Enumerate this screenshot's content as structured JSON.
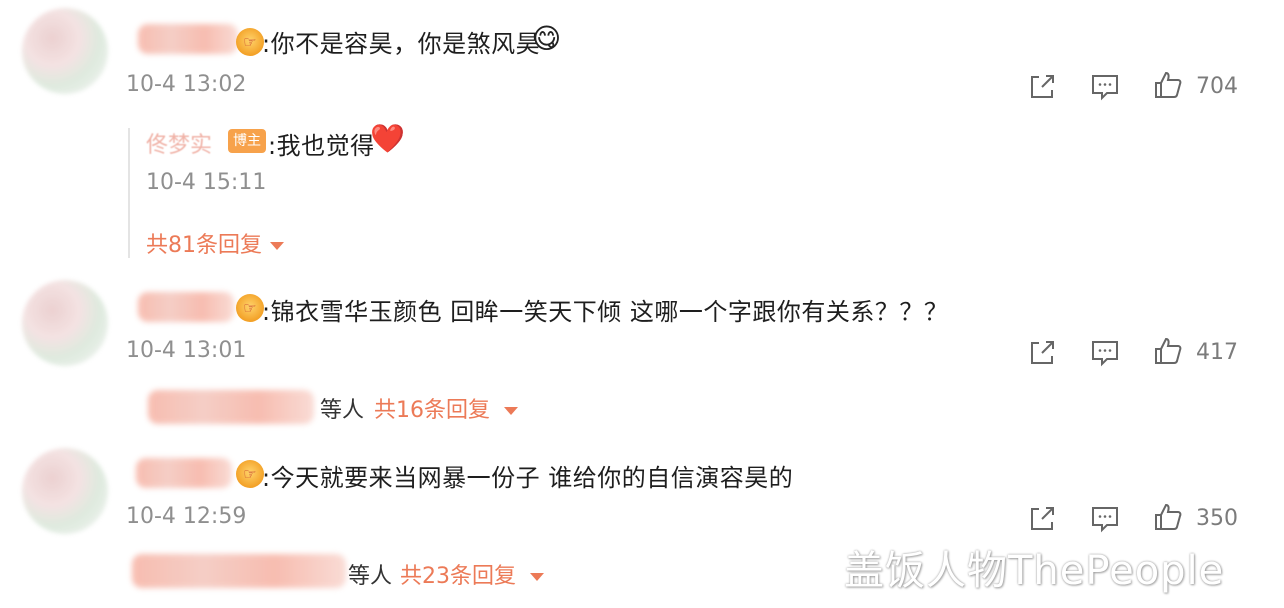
{
  "comments": [
    {
      "text": ":你不是容昊，你是煞风昊",
      "emoji": "😋",
      "time": "10-4 13:02",
      "likes": "704",
      "reply": {
        "name": "佟梦实",
        "badge": "博主",
        "text": ":我也觉得",
        "emoji": "❤️",
        "time": "10-4 15:11",
        "more": "共81条回复"
      }
    },
    {
      "text": ":锦衣雪华玉颜色 回眸一笑天下倾 这哪一个字跟你有关系？？？",
      "time": "10-4 13:01",
      "likes": "417",
      "replies_etc": "等人",
      "more": "共16条回复"
    },
    {
      "text": ":今天就要来当网暴一份子 谁给你的自信演容昊的",
      "time": "10-4 12:59",
      "likes": "350",
      "replies_etc": "等人",
      "more": "共23条回复"
    }
  ],
  "badge_glyph": "☞",
  "icons": {
    "share": "share-icon",
    "comment": "comment-icon",
    "like": "thumbs-up-icon"
  },
  "watermark": "盖饭人物ThePeople",
  "colors": {
    "link": "#ec7a57",
    "timestamp": "#8f8f8f",
    "badge": "#f7a24b"
  }
}
